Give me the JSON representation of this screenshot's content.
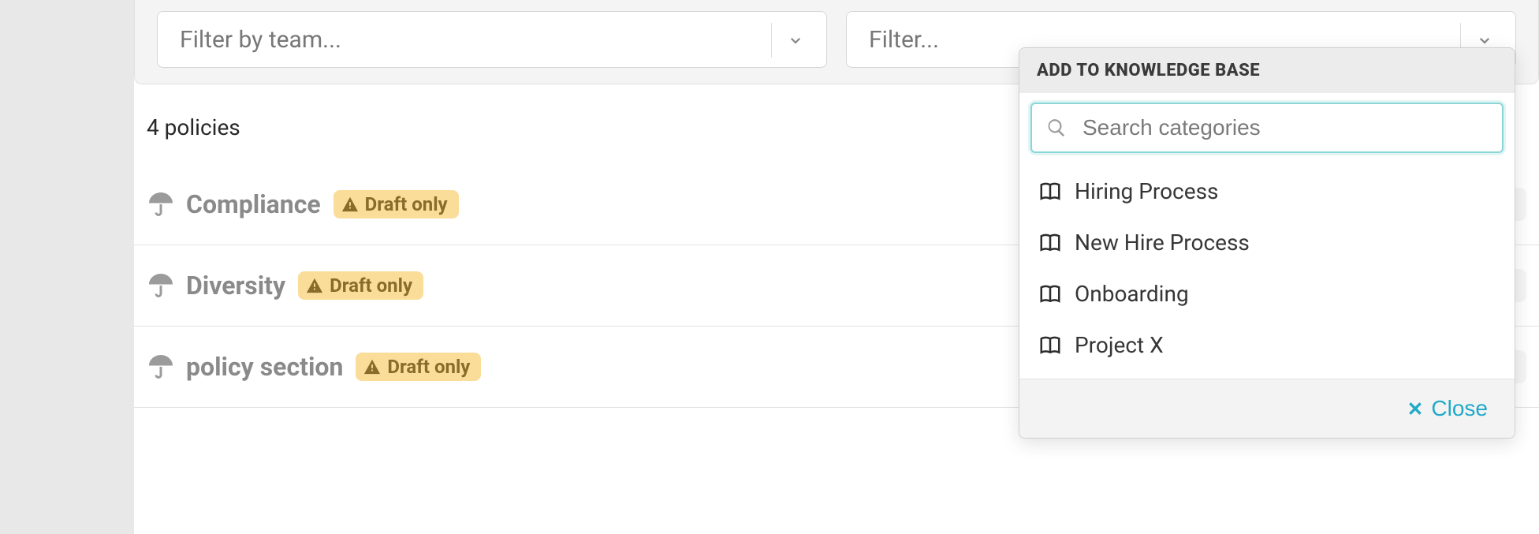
{
  "filters": {
    "team_placeholder": "Filter by team...",
    "generic_placeholder": "Filter..."
  },
  "count_text": "4 policies",
  "draft_badge_label": "Draft only",
  "policies": [
    {
      "title": "Compliance",
      "tags": "0",
      "members": "0",
      "folders": "0"
    },
    {
      "title": "Diversity",
      "tags": "0",
      "members": "0",
      "folders": "0"
    },
    {
      "title": "policy section",
      "tags": "0",
      "members": "0",
      "folders": "0"
    }
  ],
  "popover": {
    "title": "ADD TO KNOWLEDGE BASE",
    "search_placeholder": "Search categories",
    "categories": [
      "Hiring Process",
      "New Hire Process",
      "Onboarding",
      "Project X"
    ],
    "close_label": "Close"
  }
}
